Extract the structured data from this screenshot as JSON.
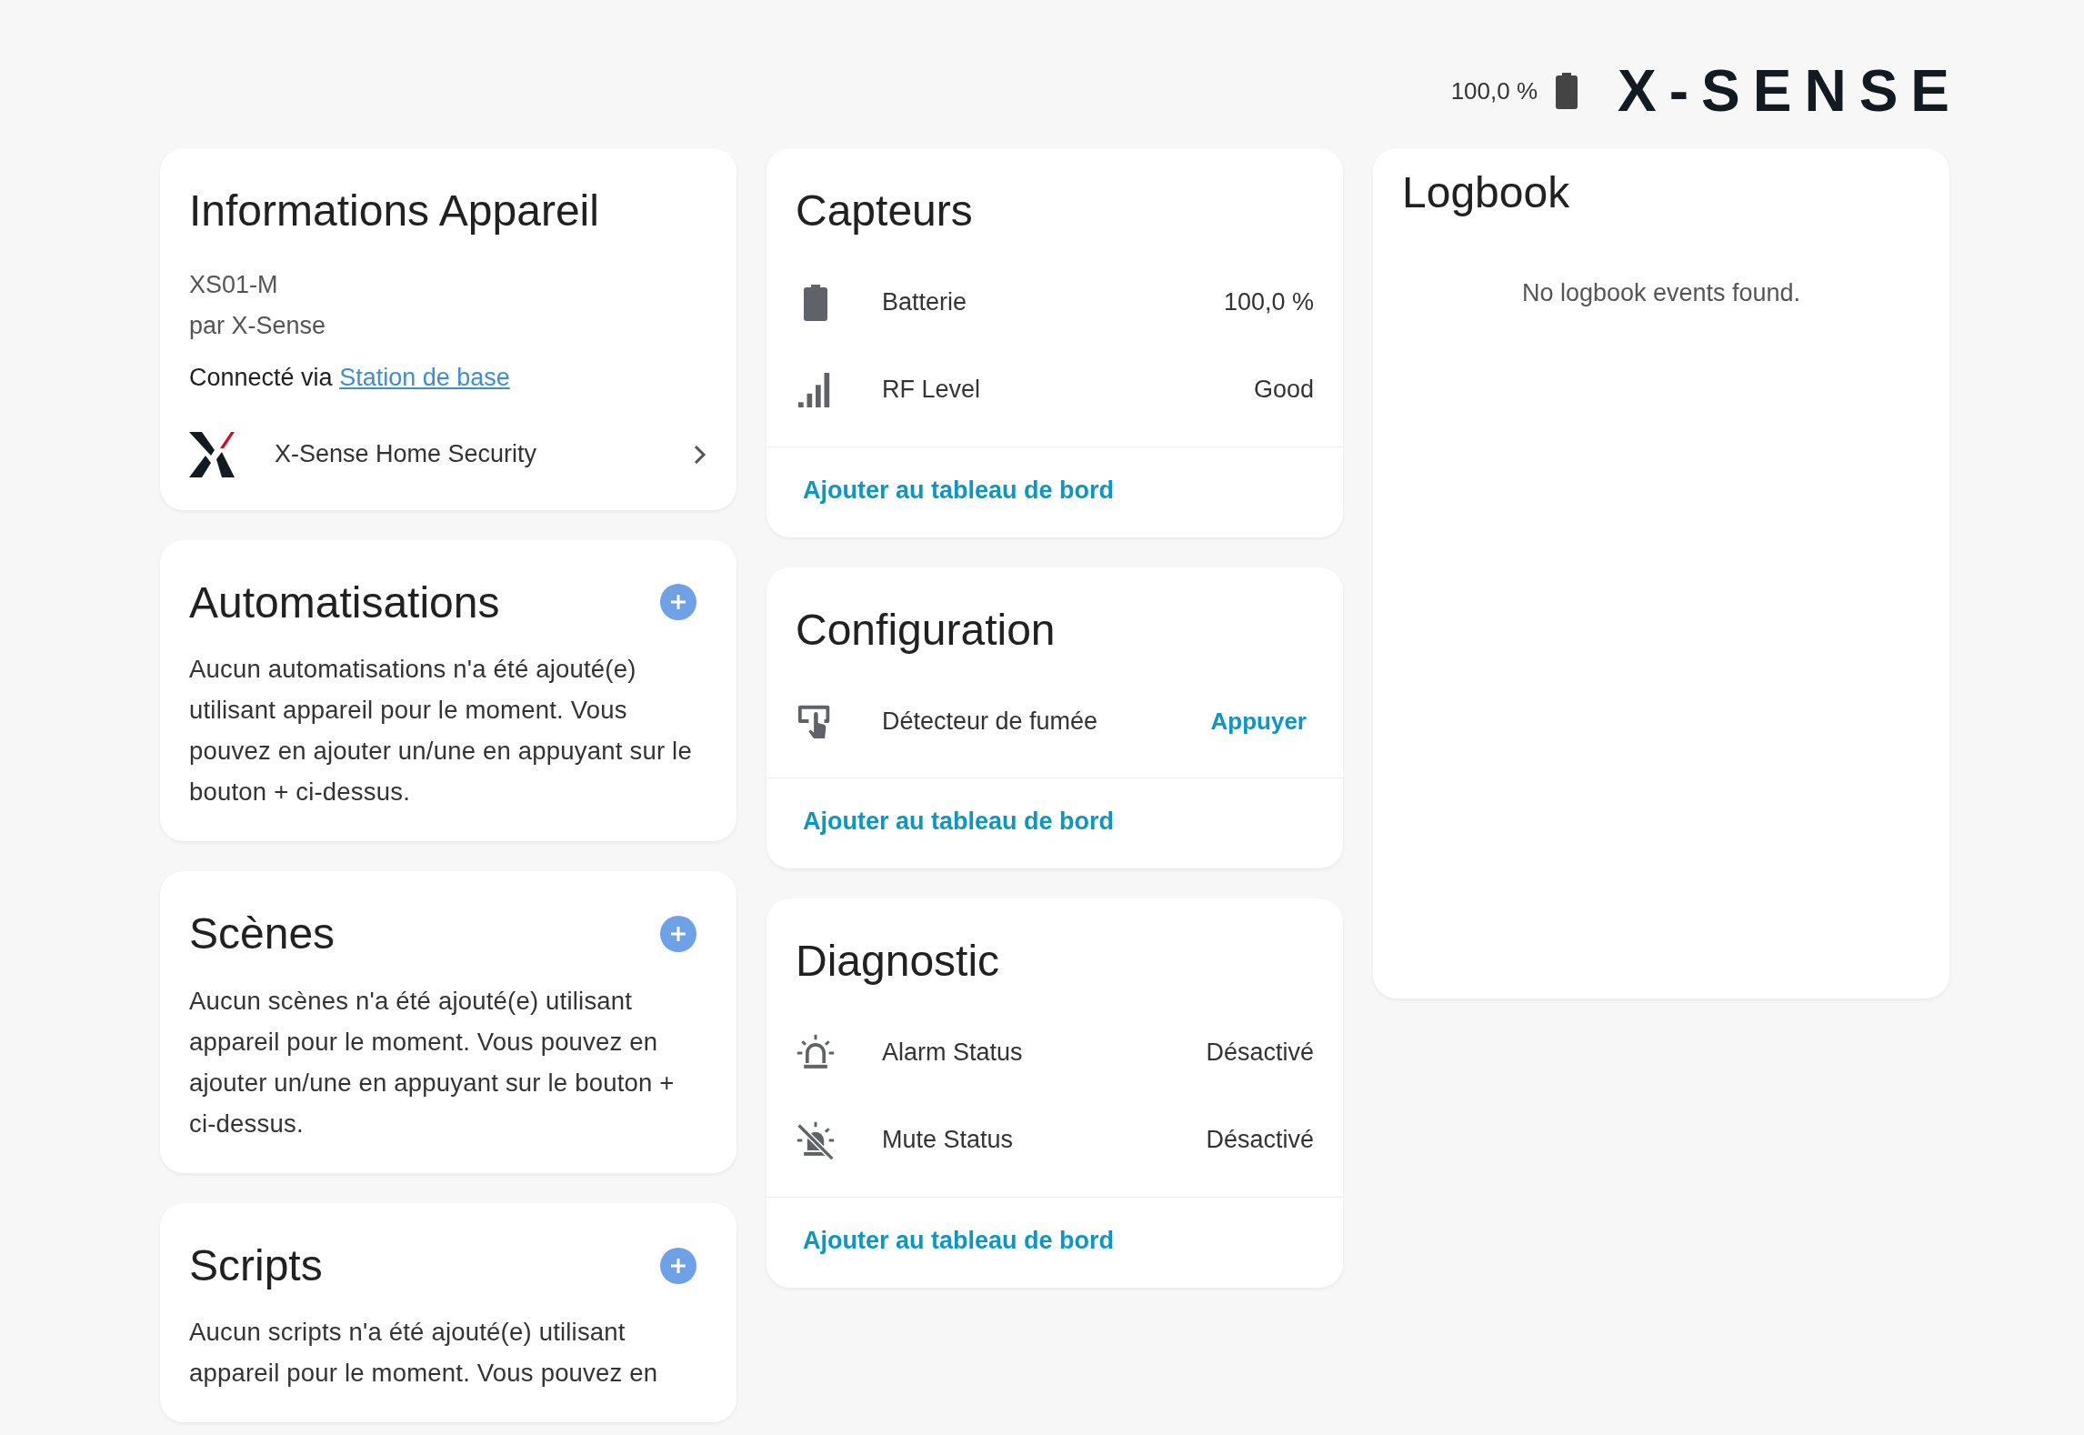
{
  "header": {
    "battery": "100,0 %",
    "logo": "X-SENSE"
  },
  "device_info": {
    "title": "Informations Appareil",
    "model": "XS01-M",
    "manufacturer": "par X-Sense",
    "connected_prefix": "Connecté via",
    "connected_link": "Station de base",
    "integration": "X-Sense Home Security"
  },
  "sections": [
    {
      "title": "Automatisations",
      "text": "Aucun automatisations n'a été ajouté(e) utilisant appareil pour le moment. Vous pouvez en ajouter un/une en appuyant sur le bouton + ci-dessus."
    },
    {
      "title": "Scènes",
      "text": "Aucun scènes n'a été ajouté(e) utilisant appareil pour le moment. Vous pouvez en ajouter un/une en appuyant sur le bouton + ci-dessus."
    },
    {
      "title": "Scripts",
      "text": "Aucun scripts n'a été ajouté(e) utilisant appareil pour le moment. Vous pouvez en"
    }
  ],
  "entity_cards": [
    {
      "title": "Capteurs",
      "rows": [
        {
          "kind": "battery",
          "name": "Batterie",
          "value": "100,0 %"
        },
        {
          "kind": "signal",
          "name": "RF Level",
          "value": "Good"
        }
      ],
      "action": "Ajouter au tableau de bord"
    },
    {
      "title": "Configuration",
      "rows": [
        {
          "kind": "press",
          "name": "Détecteur de fumée",
          "button": "Appuyer"
        }
      ],
      "action": "Ajouter au tableau de bord"
    },
    {
      "title": "Diagnostic",
      "rows": [
        {
          "kind": "alarm",
          "name": "Alarm Status",
          "value": "Désactivé"
        },
        {
          "kind": "alarm-off",
          "name": "Mute Status",
          "value": "Désactivé"
        }
      ],
      "action": "Ajouter au tableau de bord"
    }
  ],
  "logbook": {
    "title": "Logbook",
    "empty": "No logbook events found."
  }
}
